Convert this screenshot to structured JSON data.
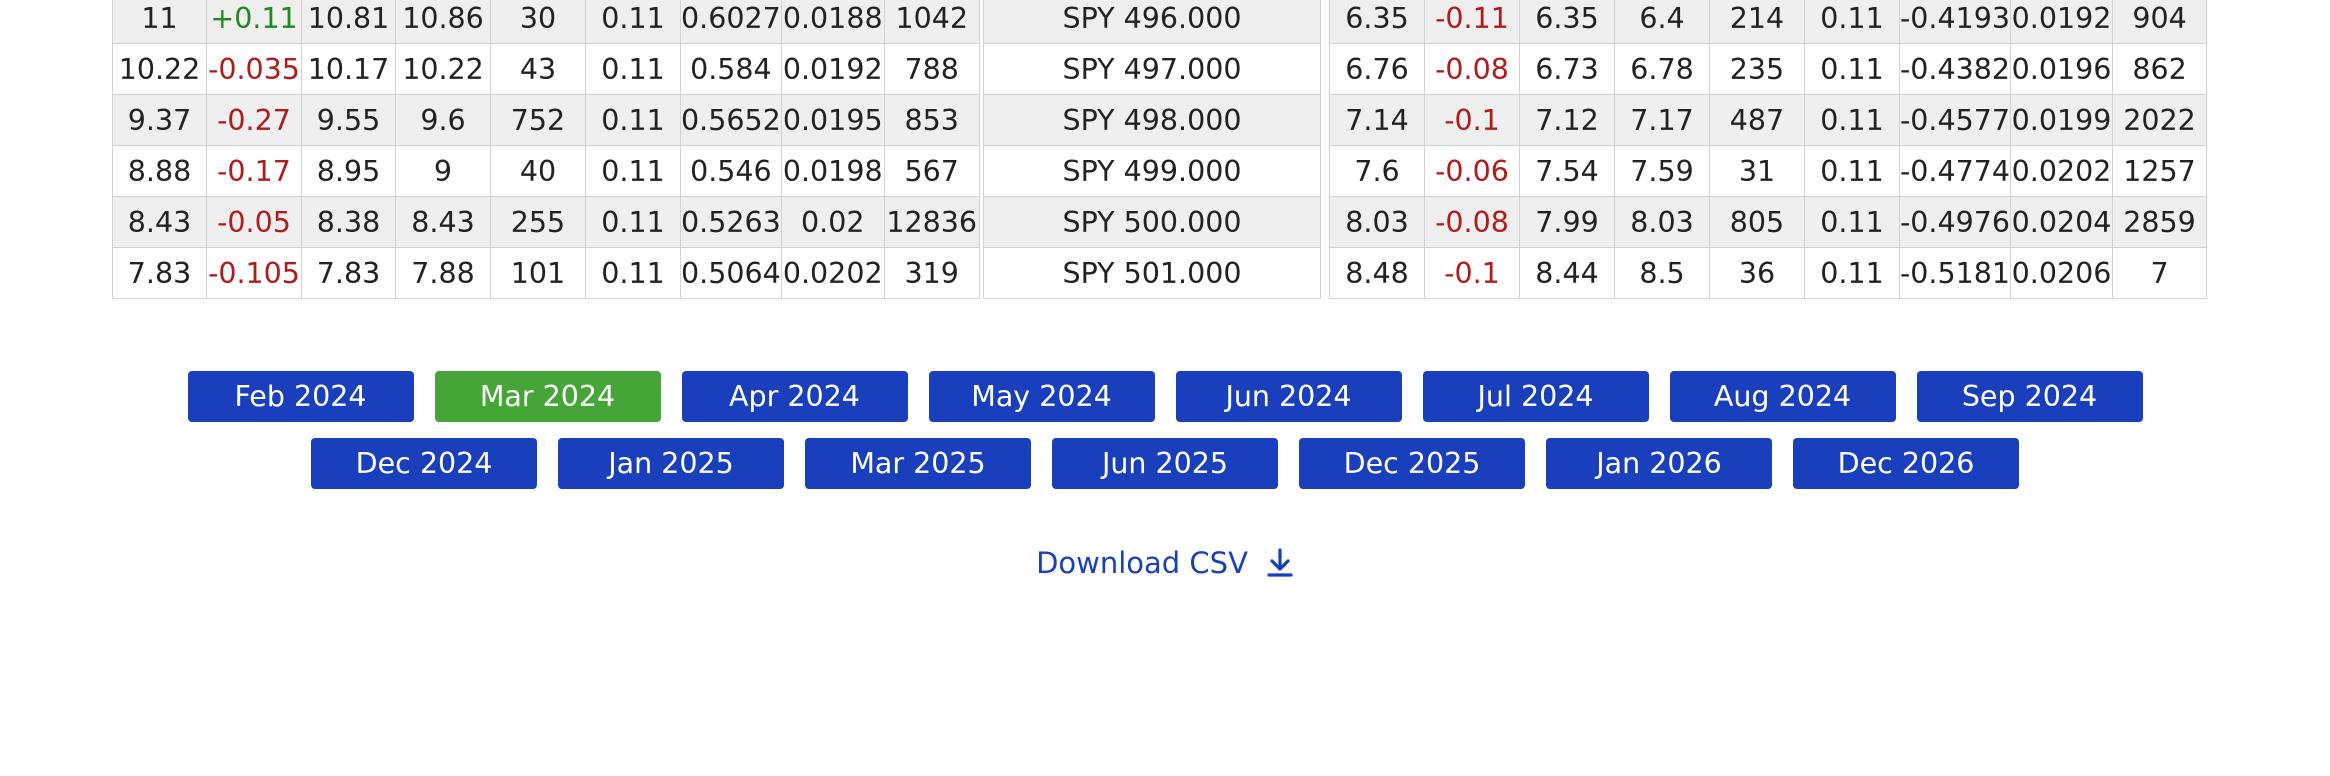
{
  "calls_table": {
    "rows": [
      [
        "11",
        "+0.11",
        "10.81",
        "10.86",
        "30",
        "0.11",
        "0.6027",
        "0.0188",
        "1042"
      ],
      [
        "10.22",
        "-0.035",
        "10.17",
        "10.22",
        "43",
        "0.11",
        "0.584",
        "0.0192",
        "788"
      ],
      [
        "9.37",
        "-0.27",
        "9.55",
        "9.6",
        "752",
        "0.11",
        "0.5652",
        "0.0195",
        "853"
      ],
      [
        "8.88",
        "-0.17",
        "8.95",
        "9",
        "40",
        "0.11",
        "0.546",
        "0.0198",
        "567"
      ],
      [
        "8.43",
        "-0.05",
        "8.38",
        "8.43",
        "255",
        "0.11",
        "0.5263",
        "0.02",
        "12836"
      ],
      [
        "7.83",
        "-0.105",
        "7.83",
        "7.88",
        "101",
        "0.11",
        "0.5064",
        "0.0202",
        "319"
      ]
    ]
  },
  "strikes": [
    "SPY 496.000",
    "SPY 497.000",
    "SPY 498.000",
    "SPY 499.000",
    "SPY 500.000",
    "SPY 501.000"
  ],
  "puts_table": {
    "rows": [
      [
        "6.35",
        "-0.11",
        "6.35",
        "6.4",
        "214",
        "0.11",
        "-0.4193",
        "0.0192",
        "904"
      ],
      [
        "6.76",
        "-0.08",
        "6.73",
        "6.78",
        "235",
        "0.11",
        "-0.4382",
        "0.0196",
        "862"
      ],
      [
        "7.14",
        "-0.1",
        "7.12",
        "7.17",
        "487",
        "0.11",
        "-0.4577",
        "0.0199",
        "2022"
      ],
      [
        "7.6",
        "-0.06",
        "7.54",
        "7.59",
        "31",
        "0.11",
        "-0.4774",
        "0.0202",
        "1257"
      ],
      [
        "8.03",
        "-0.08",
        "7.99",
        "8.03",
        "805",
        "0.11",
        "-0.4976",
        "0.0204",
        "2859"
      ],
      [
        "8.48",
        "-0.1",
        "8.44",
        "8.5",
        "36",
        "0.11",
        "-0.5181",
        "0.0206",
        "7"
      ]
    ]
  },
  "months_row1": [
    "Feb 2024",
    "Mar 2024",
    "Apr 2024",
    "May 2024",
    "Jun 2024",
    "Jul 2024",
    "Aug 2024",
    "Sep 2024"
  ],
  "months_row2": [
    "Dec 2024",
    "Jan 2025",
    "Mar 2025",
    "Jun 2025",
    "Dec 2025",
    "Jan 2026",
    "Dec 2026"
  ],
  "active_month": "Mar 2024",
  "colors": {
    "button": "#1a3fbd",
    "active_button": "#46a537",
    "negative": "#b01b1b",
    "positive": "#1f8a1f",
    "link": "#1a3fbd"
  },
  "download": {
    "label": "Download CSV",
    "icon": "download-icon"
  }
}
